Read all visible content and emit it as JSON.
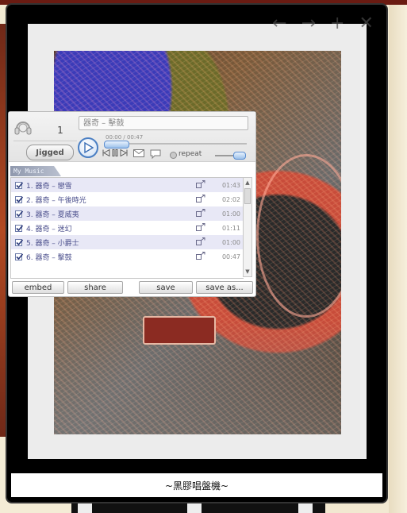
{
  "popup": {
    "controls": [
      "←",
      "→",
      "+",
      "✕"
    ],
    "caption": "~黑膠唱盤機~"
  },
  "player": {
    "play_count": "1",
    "user_button_label": "Jigged",
    "now_playing": "器奇 – 擊鼓",
    "time": "00:00 / 00:47",
    "progress": 0.0,
    "repeat_label": "repeat",
    "volume": 0.8,
    "playlist_tab": "My Music",
    "tracks": [
      {
        "title": "1. 器奇 – 戀雪",
        "duration": "01:43"
      },
      {
        "title": "2. 器奇 – 午後時光",
        "duration": "02:02"
      },
      {
        "title": "3. 器奇 – 夏威夷",
        "duration": "01:00"
      },
      {
        "title": "4. 器奇 – 迷幻",
        "duration": "01:11"
      },
      {
        "title": "5. 器奇 – 小爵士",
        "duration": "01:00"
      },
      {
        "title": "6. 器奇 – 擊鼓",
        "duration": "00:47"
      }
    ],
    "buttons": {
      "embed": "embed",
      "share": "share",
      "save": "save",
      "save_as": "save as..."
    }
  },
  "colors": {
    "accent": "#4a7fc3",
    "playlist_text": "#4b4f8c",
    "playlist_row_alt": "#e8e8f6",
    "frame": "#000000"
  }
}
